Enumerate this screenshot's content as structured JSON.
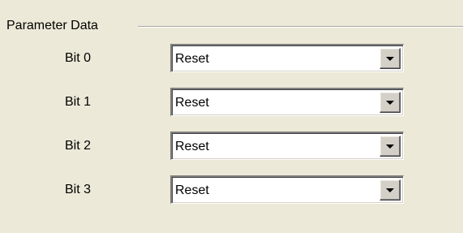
{
  "group": {
    "title": "Parameter Data"
  },
  "parameters": [
    {
      "label": "Bit 0",
      "value": "Reset"
    },
    {
      "label": "Bit 1",
      "value": "Reset"
    },
    {
      "label": "Bit 2",
      "value": "Reset"
    },
    {
      "label": "Bit 3",
      "value": "Reset"
    }
  ],
  "icons": {
    "dropdown": "chevron-down-icon"
  },
  "colors": {
    "dialog_background": "#ece9d8",
    "field_background": "#ffffff",
    "button_face": "#d4d0c8"
  }
}
